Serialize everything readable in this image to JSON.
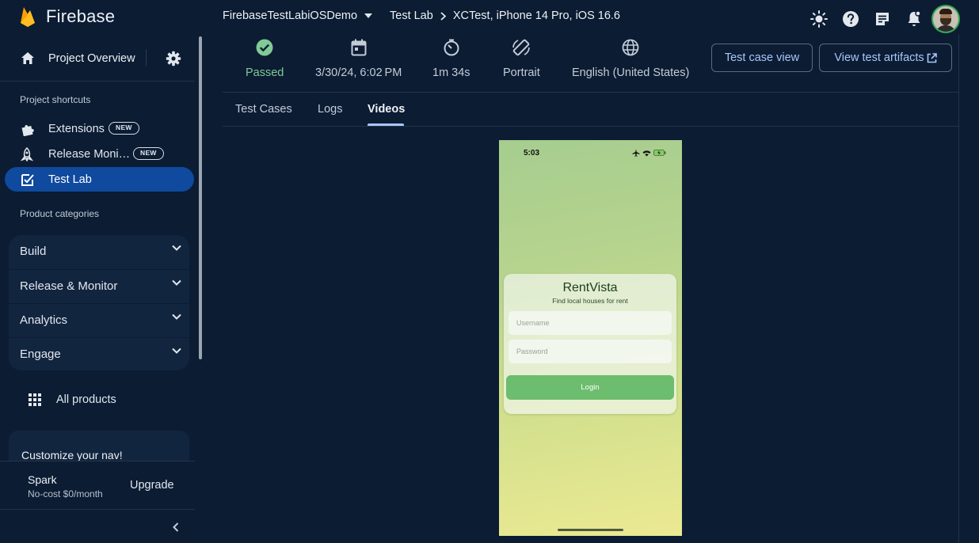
{
  "app": {
    "name": "Firebase"
  },
  "header": {
    "project": "FirebaseTestLabiOSDemo",
    "breadcrumb": [
      "Test Lab",
      "XCTest, iPhone 14 Pro, iOS 16.6"
    ],
    "icons": [
      "theme-icon",
      "help-icon",
      "notes-icon",
      "notifications-icon",
      "avatar"
    ]
  },
  "sidebar": {
    "overview": "Project Overview",
    "shortcuts_label": "Project shortcuts",
    "shortcuts": [
      {
        "label": "Extensions",
        "badge": "NEW",
        "icon": "extensions-icon"
      },
      {
        "label": "Release Moni…",
        "badge": "NEW",
        "icon": "rocket-icon"
      },
      {
        "label": "Test Lab",
        "badge": "",
        "icon": "testlab-icon",
        "active": true
      }
    ],
    "categories_label": "Product categories",
    "categories": [
      "Build",
      "Release & Monitor",
      "Analytics",
      "Engage"
    ],
    "all_products": "All products",
    "customize": "Customize your nav!",
    "plan": {
      "name": "Spark",
      "price": "No-cost $0/month",
      "upgrade": "Upgrade"
    }
  },
  "metrics": {
    "status": "Passed",
    "date": "3/30/24, 6:02 PM",
    "duration": "1m 34s",
    "orientation": "Portrait",
    "locale": "English (United States)"
  },
  "buttons": {
    "test_case_view": "Test case view",
    "view_artifacts": "View test artifacts"
  },
  "tabs": [
    "Test Cases",
    "Logs",
    "Videos"
  ],
  "active_tab": "Videos",
  "video": {
    "time": "5:03",
    "app_title": "RentVista",
    "app_subtitle": "Find local houses for rent",
    "username_placeholder": "Username",
    "password_placeholder": "Password",
    "login": "Login"
  },
  "colors": {
    "background": "#0b1c33",
    "accent": "#a8c7fa",
    "active_nav": "#0f4a9e",
    "passed": "#81c995",
    "login_button": "#6cbd6e"
  }
}
